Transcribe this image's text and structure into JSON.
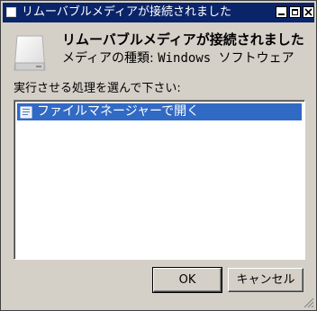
{
  "window": {
    "title": "リムーバブルメディアが接続されました",
    "controls": [
      "minimize-icon",
      "maximize-icon",
      "close-icon"
    ]
  },
  "header": {
    "icon": "removable-drive-icon",
    "heading": "リムーバブルメディアが接続されました",
    "media_type_label": "メディアの種類:",
    "media_type_value": "Windows ソフトウェア"
  },
  "prompt": "実行させる処理を選んで下さい:",
  "actions": [
    {
      "label": "ファイルマネージャーで開く",
      "icon": "file-manager-icon",
      "selected": true
    }
  ],
  "buttons": {
    "ok": "OK",
    "cancel": "キャンセル"
  },
  "colors": {
    "titlebar": "#0a246a",
    "selection": "#316ac5",
    "face": "#d4d0c8"
  }
}
